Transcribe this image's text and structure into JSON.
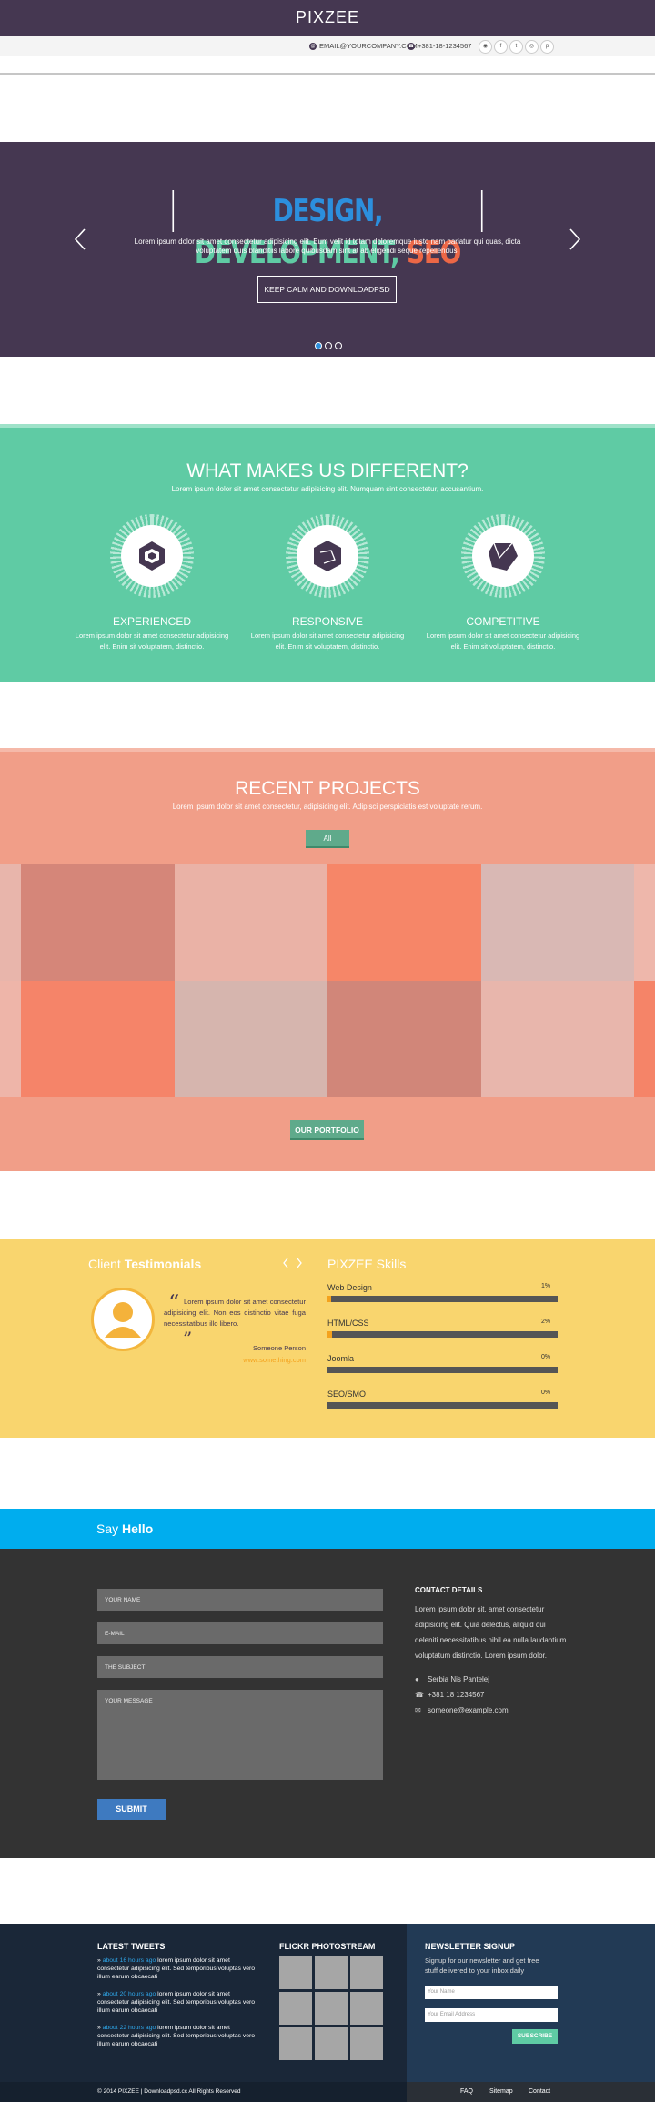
{
  "header": {
    "logo": "PIXZEE",
    "email": "EMAIL@YOURCOMPANY.COM",
    "phone": "+381-18-1234567",
    "social": [
      "rss-icon",
      "facebook-icon",
      "twitter-icon",
      "dribbble-icon",
      "pinterest-icon"
    ]
  },
  "hero": {
    "title_parts": [
      "DESIGN, ",
      "DEVELOPMENT, ",
      "SEO"
    ],
    "title_colors": [
      "#2c8fdd",
      "#5fcba4",
      "#ec6746"
    ],
    "subtitle_1": "Lorem ipsum dolor sit amet consectetur adipisicing elit. Eum velit id totam doloremque iusto nam pariatur qui quas, dicta",
    "subtitle_2": "voluptatem quis blanditiis labore quibusdam sint at ab eligendi seque repellendus.",
    "button": "KEEP CALM AND DOWNLOADPSD"
  },
  "features": {
    "title": "WHAT MAKES US DIFFERENT?",
    "subtitle": "Lorem ipsum dolor sit amet consectetur adipisicing elit. Numquam sint consectetur, accusantium.",
    "items": [
      {
        "title": "EXPERIENCED",
        "desc": "Lorem ipsum dolor sit amet consectetur adipisicing elit. Enim sit voluptatem, distinctio."
      },
      {
        "title": "RESPONSIVE",
        "desc": "Lorem ipsum dolor sit amet consectetur adipisicing elit. Enim sit voluptatem, distinctio."
      },
      {
        "title": "COMPETITIVE",
        "desc": "Lorem ipsum dolor sit amet consectetur adipisicing elit. Enim sit voluptatem, distinctio."
      }
    ]
  },
  "projects": {
    "title": "RECENT PROJECTS",
    "subtitle": "Lorem ipsum dolor sit amet consectetur, adipisicing elit. Adipisci perspiciatis est voluptate rerum.",
    "filter": "All",
    "portfolio_button": "OUR PORTFOLIO",
    "tile_colors": [
      "#e8b5ab",
      "#d58679",
      "#eab2a6",
      "#f68668",
      "#d9b8b4",
      "#eeb7ab",
      "#eeb5a9",
      "#f58469",
      "#d6b5ae",
      "#d18679",
      "#e8b6ac",
      "#f58468"
    ]
  },
  "testimonials": {
    "title_light": "Client ",
    "title_bold": "Testimonials",
    "quote": "Lorem ipsum dolor sit amet consectetur adipisicing elit. Non eos distinctio vitae fuga necessitatibus illo libero.",
    "person": "Someone Person",
    "link": "www.something.com"
  },
  "skills": {
    "title": "PIXZEE Skills",
    "items": [
      {
        "name": "Web Design",
        "label": "1%",
        "value": 0.01
      },
      {
        "name": "HTML/CSS",
        "label": "2%",
        "value": 0.02
      },
      {
        "name": "Joomla",
        "label": "0%",
        "value": 0
      },
      {
        "name": "SEO/SMO",
        "label": "0%",
        "value": 0
      }
    ]
  },
  "contact": {
    "say": "Say ",
    "hello": "Hello",
    "placeholders": [
      "YOUR NAME",
      "E-MAIL",
      "THE SUBJECT",
      "YOUR MESSAGE"
    ],
    "submit": "SUBMIT",
    "details_title": "CONTACT DETAILS",
    "details_text": [
      "Lorem ipsum dolor sit, amet consectetur",
      "adipisicing elit. Quia delectus, aliquid qui",
      "deleniti necessitatibus nihil ea nulla laudantium",
      "voluptatum distinctio. Lorem ipsum dolor."
    ],
    "address": "Serbia Nis Pantelej",
    "phone": "+381 18 1234567",
    "email": "someone@example.com"
  },
  "footer": {
    "tweets_title": "LATEST TWEETS",
    "tweets": [
      {
        "time": "about 16 hours ago",
        "text": " lorem ipsum dolor sit amet consectetur adipisicing elit. Sed temporibus voluptas vero illum earum obcaecati"
      },
      {
        "time": "about 20 hours ago",
        "text": " lorem ipsum dolor sit amet consectetur adipisicing elit. Sed temporibus voluptas vero illum earum obcaecati"
      },
      {
        "time": "about 22 hours ago",
        "text": " lorem ipsum dolor sit amet consectetur adipisicing elit. Sed temporibus voluptas vero illum earum obcaecati"
      }
    ],
    "flickr_title": "FLICKR PHOTOSTREAM",
    "newsletter_title": "NEWSLETTER SIGNUP",
    "newsletter_text_1": "Signup for our newsletter and get free",
    "newsletter_text_2": "stuff delivered to your inbox daily",
    "name_placeholder": "Your Name",
    "email_placeholder": "Your Email Address",
    "subscribe": "SUBSCRIBE",
    "copyright": "© 2014 PIXZEE | Downloadpsd.cc All Rights Reserved",
    "links": [
      "FAQ",
      "Sitemap",
      "Contact"
    ]
  }
}
